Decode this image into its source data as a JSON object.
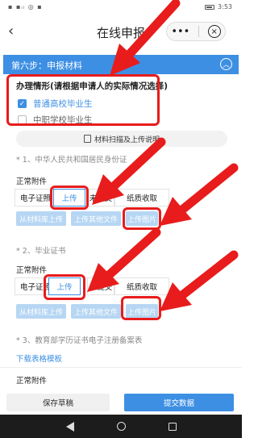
{
  "status_bar": {
    "left_icons": "▪ ▪ᵢₗ ◎ ▪",
    "time": "3:53"
  },
  "nav": {
    "back": "‹",
    "title": "在线申报",
    "more": "•••",
    "close": "×"
  },
  "step": {
    "title": "第六步：申报材料",
    "collapse": "︿"
  },
  "situation": {
    "title": "办理情形(请根据申请人的实际情况选择)",
    "options": [
      {
        "label": "普通高校毕业生",
        "checked": true
      },
      {
        "label": "中职学校毕业生",
        "checked": false
      }
    ]
  },
  "guide_button": "材料扫描及上传说明",
  "materials": [
    {
      "title": "* 1、中华人民共和国居民身份证",
      "sub_label": "正常附件",
      "cells": [
        "电子证照",
        "上传",
        "未提交",
        "纸质收取"
      ],
      "actions": [
        "从材料库上传",
        "上传其他文件",
        "上传图片"
      ]
    },
    {
      "title": "* 2、毕业证书",
      "sub_label": "正常附件",
      "cells": [
        "电子证照",
        "上传",
        "未提交",
        "纸质收取"
      ],
      "actions": [
        "从材料库上传",
        "上传其他文件",
        "上传图片"
      ]
    },
    {
      "title": "* 3、教育部学历证书电子注册备案表",
      "download": "下载表格模板",
      "sub_label": "正常附件"
    }
  ],
  "bottom": {
    "draft": "保存草稿",
    "submit": "提交数据"
  },
  "colors": {
    "accent": "#3d8fe3",
    "annotation": "#e81c1c",
    "light_button": "#b6d6f3"
  }
}
